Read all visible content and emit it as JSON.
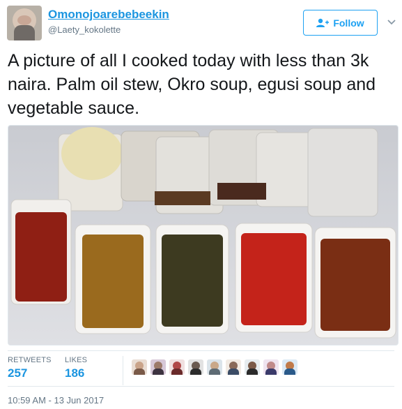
{
  "user": {
    "display_name": "Omonojoarebebeekin",
    "handle": "@Laety_kokolette"
  },
  "follow_button": {
    "label": "Follow"
  },
  "tweet": {
    "text": "A picture of all I cooked today with less than 3k naira. Palm oil stew, Okro soup, egusi soup and vegetable sauce."
  },
  "stats": {
    "retweets_label": "RETWEETS",
    "retweets_count": "257",
    "likes_label": "LIKES",
    "likes_count": "186"
  },
  "likers_count": 9,
  "timestamp": "10:59 AM - 13 Jun 2017",
  "colors": {
    "brand_blue": "#1da1f2",
    "link_blue": "#1b95e0",
    "muted_gray": "#657786"
  },
  "icons": [
    "follow-person-plus-icon",
    "chevron-down-icon"
  ]
}
